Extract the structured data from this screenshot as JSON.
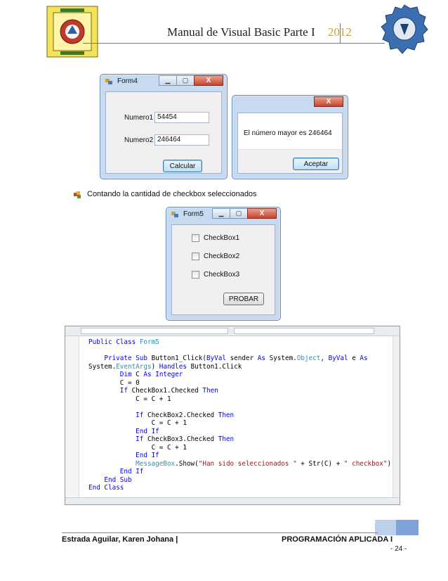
{
  "header": {
    "title": "Manual de Visual Basic Parte I",
    "year": "2012"
  },
  "form4": {
    "title": "Form4",
    "labels": [
      "Numero1",
      "Numero2"
    ],
    "values": [
      "54454",
      "246464"
    ],
    "button": "Calcular"
  },
  "msgbox": {
    "close": "X",
    "message": "El número mayor es 246464",
    "button": "Aceptar"
  },
  "bullet": {
    "text": "Contando la cantidad de checkbox seleccionados"
  },
  "form5": {
    "title": "Form5",
    "checkboxes": [
      "CheckBox1",
      "CheckBox2",
      "CheckBox3"
    ],
    "button": "PROBAR"
  },
  "code": {
    "lines": [
      "Public Class Form5",
      "",
      "    Private Sub Button1_Click(ByVal sender As System.Object, ByVal e As",
      "System.EventArgs) Handles Button1.Click",
      "        Dim C As Integer",
      "        C = 0",
      "        If CheckBox1.Checked Then",
      "            C = C + 1",
      "",
      "            If CheckBox2.Checked Then",
      "                C = C + 1",
      "            End If",
      "            If CheckBox3.Checked Then",
      "                C = C + 1",
      "            End If",
      "            MessageBox.Show(\"Han sido seleccionados \" + Str(C) + \" checkbox\")",
      "        End If",
      "    End Sub",
      "End Class"
    ]
  },
  "footer": {
    "author": "Estrada Aguilar, Karen Johana |",
    "course": "PROGRAMACIÓN APLICADA I",
    "page": "- 24 -"
  },
  "colors": {
    "window_border": "#6b8db5",
    "keyword": "#0000ff",
    "type": "#2b91af",
    "string": "#a31515",
    "year": "#c9a24a"
  }
}
